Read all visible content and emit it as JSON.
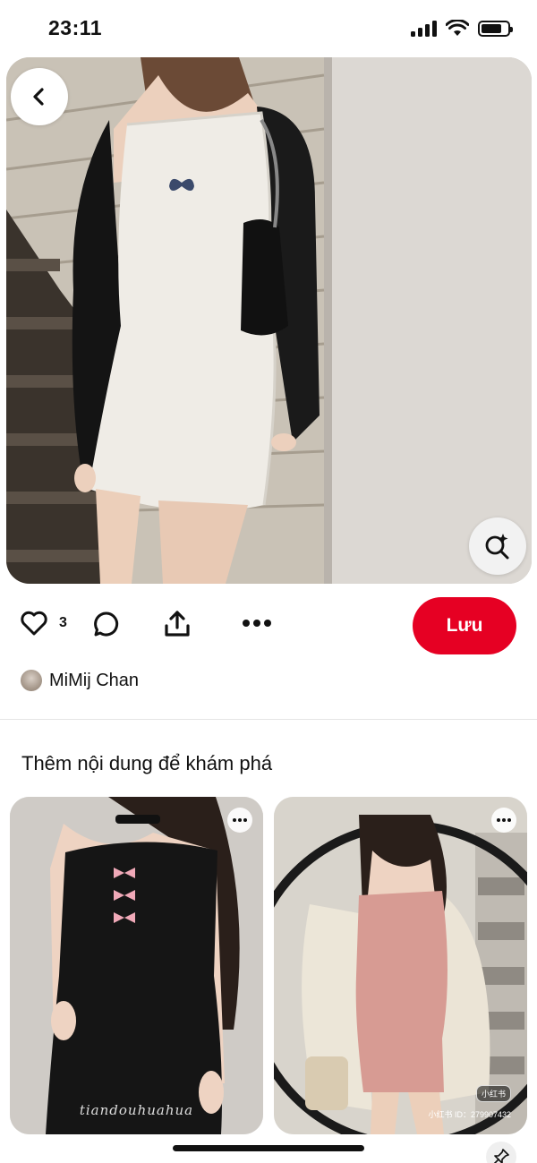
{
  "status_bar": {
    "time": "23:11",
    "icons": [
      "signal-icon",
      "wifi-icon",
      "battery-icon"
    ]
  },
  "pin": {
    "back_icon": "chevron-left-icon",
    "visual_search_icon": "magnifier-sparkle-icon",
    "like_count": "3",
    "save_label": "Lưu",
    "creator_name": "MiMij Chan"
  },
  "colors": {
    "save_button": "#e60023",
    "text": "#111111"
  },
  "more": {
    "title": "Thêm nội dung để khám phá",
    "cards": [
      {
        "watermark": "tiandouhuahua"
      },
      {
        "badge": "小红书",
        "id_text": "小红书 ID：279907432"
      }
    ]
  }
}
